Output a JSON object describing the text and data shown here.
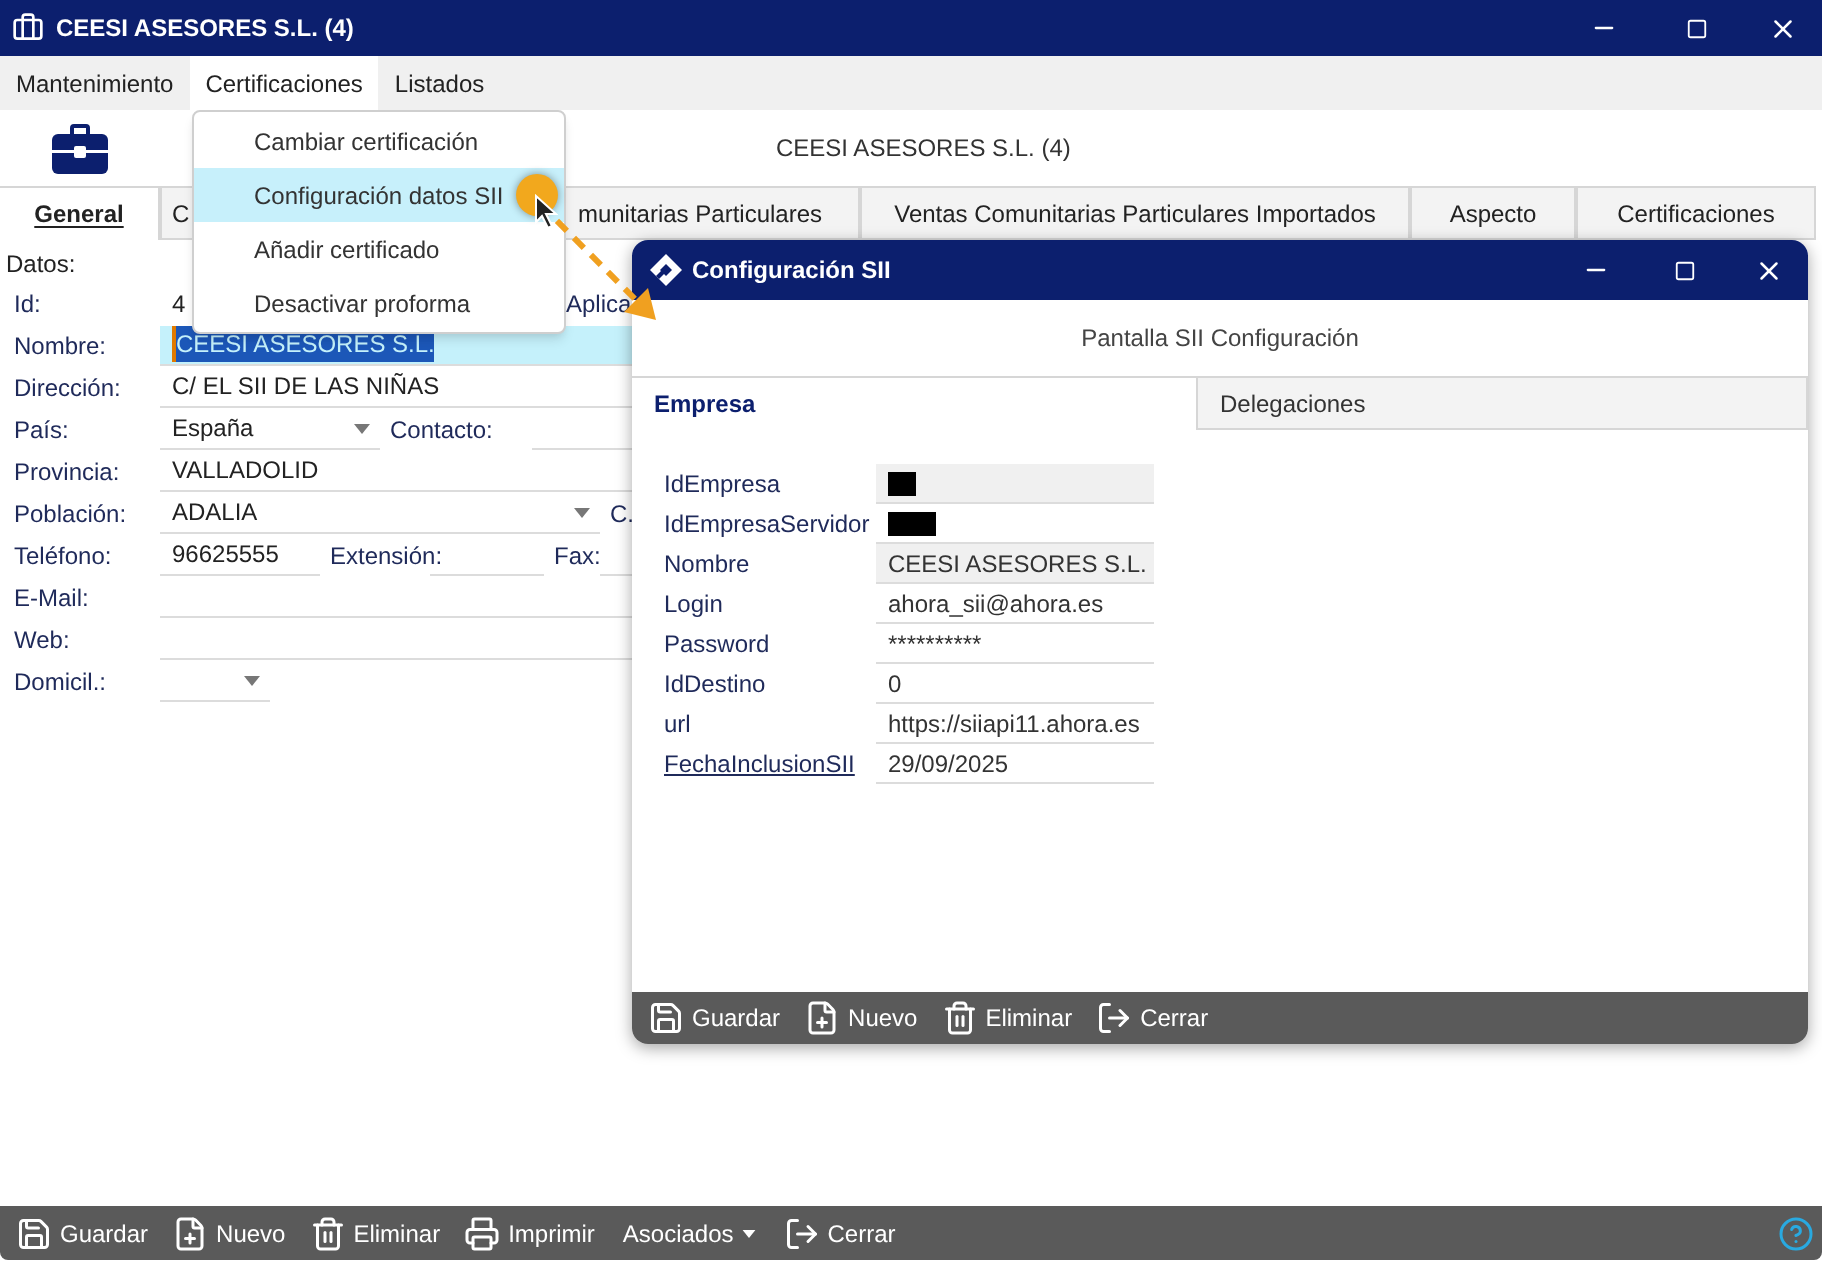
{
  "window": {
    "title": "CEESI ASESORES S.L. (4)"
  },
  "menu": [
    {
      "label": "Mantenimiento",
      "selected": false
    },
    {
      "label": "Certificaciones",
      "selected": true
    },
    {
      "label": "Listados",
      "selected": false
    }
  ],
  "dropdown": {
    "items": [
      {
        "label": "Cambiar certificación",
        "selected": false
      },
      {
        "label": "Configuración datos SII",
        "selected": true
      },
      {
        "label": "Añadir certificado",
        "selected": false
      },
      {
        "label": "Desactivar proforma",
        "selected": false
      }
    ]
  },
  "header": {
    "title": "CEESI ASESORES S.L. (4)"
  },
  "tabs": [
    {
      "label": "General",
      "selected": true
    },
    {
      "label": "C",
      "selected": false
    },
    {
      "label": "munitarias Particulares",
      "selected": false
    },
    {
      "label": "Ventas Comunitarias Particulares Importados",
      "selected": false
    },
    {
      "label": "Aspecto",
      "selected": false
    },
    {
      "label": "Certificaciones",
      "selected": false
    }
  ],
  "form": {
    "heading": "Datos:",
    "rows": [
      {
        "label": "Id:",
        "items": [
          {
            "kind": "value",
            "value": "4"
          },
          {
            "kind": "label",
            "text": "Aplica"
          }
        ]
      },
      {
        "label": "Nombre:",
        "items": [
          {
            "kind": "input",
            "value": "CEESI ASESORES S.L.",
            "focused": true
          }
        ]
      },
      {
        "label": "Dirección:",
        "items": [
          {
            "kind": "input",
            "value": "C/ EL SII DE LAS NIÑAS",
            "focused": false
          }
        ]
      },
      {
        "label": "País:",
        "items": [
          {
            "kind": "select",
            "value": "España"
          },
          {
            "kind": "label",
            "text": "Contacto:"
          },
          {
            "kind": "input",
            "focused": false
          }
        ]
      },
      {
        "label": "Provincia:",
        "items": [
          {
            "kind": "input",
            "value": "VALLADOLID",
            "focused": false
          }
        ]
      },
      {
        "label": "Población:",
        "items": [
          {
            "kind": "select",
            "value": "ADALIA"
          },
          {
            "kind": "label",
            "text": "C."
          }
        ]
      },
      {
        "label": "Teléfono:",
        "items": [
          {
            "kind": "input",
            "value": "96625555",
            "focused": false
          },
          {
            "kind": "label",
            "text": "Extensión:"
          },
          {
            "kind": "input",
            "focused": false
          },
          {
            "kind": "label",
            "text": "Fax:"
          },
          {
            "kind": "input",
            "focused": false
          }
        ]
      },
      {
        "label": "E-Mail:",
        "items": [
          {
            "kind": "input",
            "focused": false
          }
        ]
      },
      {
        "label": "Web:",
        "items": [
          {
            "kind": "input",
            "focused": false
          }
        ]
      },
      {
        "label": "Domicil.:",
        "items": [
          {
            "kind": "select"
          }
        ]
      }
    ]
  },
  "toolbar": [
    {
      "label": "Guardar",
      "kind": "save"
    },
    {
      "label": "Nuevo",
      "kind": "new"
    },
    {
      "label": "Eliminar",
      "kind": "delete"
    },
    {
      "label": "Imprimir",
      "kind": "print"
    },
    {
      "label": "Asociados",
      "kind": "dropdown"
    },
    {
      "label": "Cerrar",
      "kind": "close"
    },
    {
      "kind": "help"
    }
  ],
  "dialog": {
    "title": "Configuración SII",
    "subtitle": "Pantalla SII Configuración",
    "tabs": [
      {
        "label": "Empresa",
        "selected": true
      },
      {
        "label": "Delegaciones",
        "selected": false
      }
    ],
    "fields": [
      {
        "label": "IdEmpresa",
        "readonly": true,
        "redacted": true,
        "link": false
      },
      {
        "label": "IdEmpresaServidor",
        "readonly": false,
        "redacted": true,
        "link": false
      },
      {
        "label": "Nombre",
        "value": "CEESI ASESORES S.L.",
        "readonly": true,
        "redacted": false,
        "link": false
      },
      {
        "label": "Login",
        "value": "ahora_sii@ahora.es",
        "readonly": false,
        "redacted": false,
        "link": false
      },
      {
        "label": "Password",
        "value": "**********",
        "readonly": false,
        "redacted": false,
        "link": false
      },
      {
        "label": "IdDestino",
        "value": "0",
        "readonly": false,
        "redacted": false,
        "link": false
      },
      {
        "label": "url",
        "value": "https://siiapi11.ahora.es",
        "readonly": false,
        "redacted": false,
        "link": false
      },
      {
        "label": "FechaInclusionSII",
        "value": "29/09/2025",
        "readonly": false,
        "redacted": false,
        "link": true
      }
    ],
    "toolbar": [
      {
        "label": "Guardar",
        "kind": "save"
      },
      {
        "label": "Nuevo",
        "kind": "new"
      },
      {
        "label": "Eliminar",
        "kind": "delete"
      },
      {
        "label": "Cerrar",
        "kind": "close"
      }
    ]
  }
}
